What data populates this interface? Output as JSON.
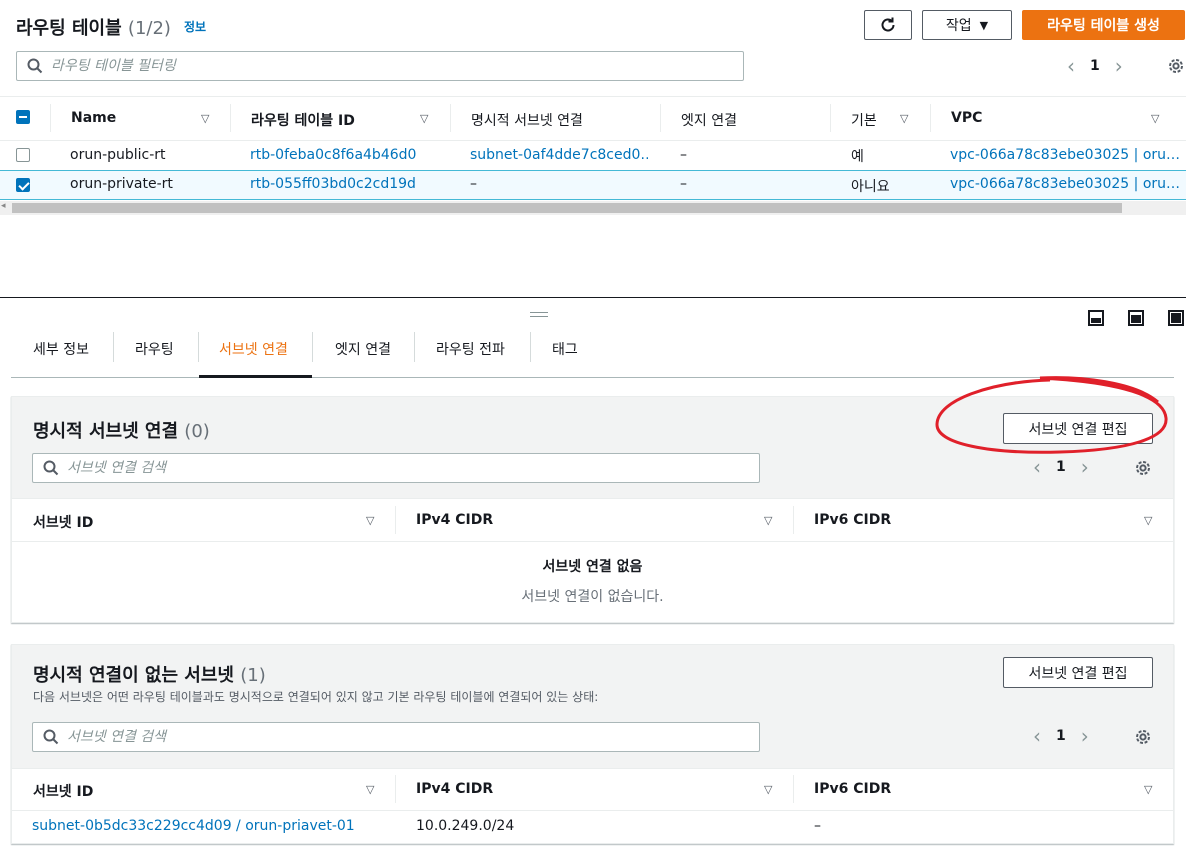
{
  "header": {
    "title": "라우팅 테이블",
    "count": "(1/2)",
    "info_link": "정보",
    "refresh_icon": "refresh-icon",
    "actions_label": "작업",
    "create_label": "라우팅 테이블 생성",
    "filter_placeholder": "라우팅 테이블 필터링",
    "page": "1"
  },
  "route_table": {
    "columns": [
      "Name",
      "라우팅 테이블 ID",
      "명시적 서브넷 연결",
      "엣지 연결",
      "기본",
      "VPC"
    ],
    "rows": [
      {
        "name": "orun-public-rt",
        "id": "rtb-0feba0c8f6a4b46d0",
        "subnet": "subnet-0af4dde7c8ced0…",
        "edge": "–",
        "main": "예",
        "vpc": "vpc-066a78c83ebe03025 | oru…",
        "selected": false
      },
      {
        "name": "orun-private-rt",
        "id": "rtb-055ff03bd0c2cd19d",
        "subnet": "–",
        "edge": "–",
        "main": "아니요",
        "vpc": "vpc-066a78c83ebe03025 | oru…",
        "selected": true
      }
    ]
  },
  "tabs": [
    {
      "label": "세부 정보",
      "active": false
    },
    {
      "label": "라우팅",
      "active": false
    },
    {
      "label": "서브넷 연결",
      "active": true
    },
    {
      "label": "엣지 연결",
      "active": false
    },
    {
      "label": "라우팅 전파",
      "active": false
    },
    {
      "label": "태그",
      "active": false
    }
  ],
  "explicit": {
    "title": "명시적 서브넷 연결",
    "count": "(0)",
    "edit_label": "서브넷 연결 편집",
    "search_placeholder": "서브넷 연결 검색",
    "page": "1",
    "columns": [
      "서브넷 ID",
      "IPv4 CIDR",
      "IPv6 CIDR"
    ],
    "empty_title": "서브넷 연결 없음",
    "empty_desc": "서브넷 연결이 없습니다."
  },
  "implicit": {
    "title": "명시적 연결이 없는 서브넷",
    "count": "(1)",
    "description": "다음 서브넷은 어떤 라우팅 테이블과도 명시적으로 연결되어 있지 않고 기본 라우팅 테이블에 연결되어 있는 상태:",
    "edit_label": "서브넷 연결 편집",
    "search_placeholder": "서브넷 연결 검색",
    "page": "1",
    "columns": [
      "서브넷 ID",
      "IPv4 CIDR",
      "IPv6 CIDR"
    ],
    "rows": [
      {
        "subnet": "subnet-0b5dc33c229cc4d09 / orun-priavet-01",
        "ipv4": "10.0.249.0/24",
        "ipv6": "–"
      }
    ]
  },
  "colors": {
    "accent": "#ec7211",
    "link": "#0073bb",
    "annotation": "#e0202a"
  }
}
